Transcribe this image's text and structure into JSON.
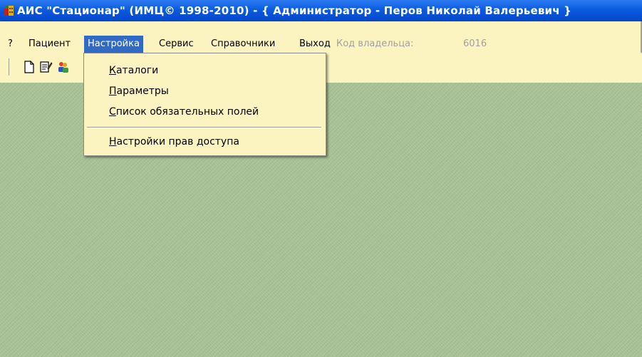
{
  "window": {
    "title": "АИС \"Стационар\"  (ИМЦ© 1998-2010) - { Администратор - Перов Николай Валерьевич }",
    "icon": "app-icon"
  },
  "menubar": {
    "items": [
      {
        "label": "?",
        "name": "menu-help"
      },
      {
        "label": "Пациент",
        "name": "menu-patient"
      },
      {
        "label": "Настройка",
        "name": "menu-settings",
        "active": true
      },
      {
        "label": "Сервис",
        "name": "menu-service"
      },
      {
        "label": "Справочники",
        "name": "menu-references"
      },
      {
        "label": "Выход",
        "name": "menu-exit"
      }
    ],
    "owner_code_label": "Код владельца:",
    "owner_code_value": "6016"
  },
  "toolbar": {
    "buttons": [
      {
        "name": "new-document-icon"
      },
      {
        "name": "edit-document-icon"
      },
      {
        "name": "users-icon"
      }
    ]
  },
  "dropdown": {
    "items": [
      {
        "label": "Каталоги",
        "accel": "К",
        "rest": "аталоги",
        "name": "dropdown-item-catalogs"
      },
      {
        "label": "Параметры",
        "accel": "П",
        "rest": "араметры",
        "name": "dropdown-item-parameters"
      },
      {
        "label": "Список обязательных полей",
        "accel": "С",
        "rest": "писок обязательных полей",
        "name": "dropdown-item-required-fields"
      },
      {
        "label": "Настройки прав доступа",
        "accel": "Н",
        "rest": "астройки прав доступа",
        "name": "dropdown-item-access-rights"
      }
    ]
  },
  "colors": {
    "titlebar": "#0a5be0",
    "menubar_bg": "#fbf4c0",
    "highlight": "#316ac5",
    "workspace": "#a9c295"
  }
}
